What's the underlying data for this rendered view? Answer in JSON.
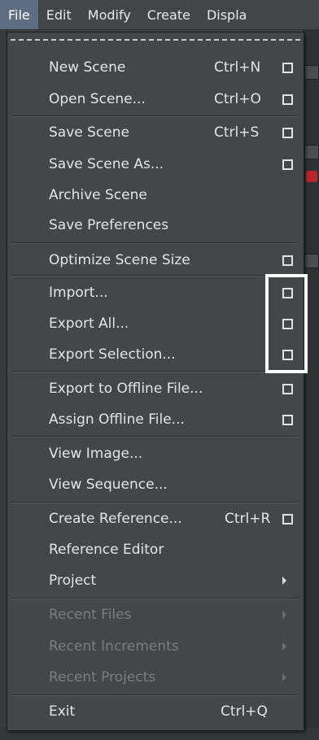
{
  "menubar": {
    "items": [
      "File",
      "Edit",
      "Modify",
      "Create",
      "Displa"
    ]
  },
  "menu": {
    "groups": {
      "scene": [
        {
          "label": "New Scene",
          "shortcut": "Ctrl+N",
          "options": true
        },
        {
          "label": "Open Scene...",
          "shortcut": "Ctrl+O",
          "options": true
        }
      ],
      "save": [
        {
          "label": "Save Scene",
          "shortcut": "Ctrl+S",
          "options": true
        },
        {
          "label": "Save Scene As...",
          "shortcut": "",
          "options": true
        },
        {
          "label": "Archive Scene",
          "shortcut": "",
          "options": false
        },
        {
          "label": "Save Preferences",
          "shortcut": "",
          "options": false
        }
      ],
      "optimize": [
        {
          "label": "Optimize Scene Size",
          "shortcut": "",
          "options": true
        }
      ],
      "io": [
        {
          "label": "Import...",
          "shortcut": "",
          "options": true
        },
        {
          "label": "Export All...",
          "shortcut": "",
          "options": true
        },
        {
          "label": "Export Selection...",
          "shortcut": "",
          "options": true
        }
      ],
      "offline": [
        {
          "label": "Export to Offline File...",
          "shortcut": "",
          "options": true
        },
        {
          "label": "Assign Offline File...",
          "shortcut": "",
          "options": true
        }
      ],
      "view": [
        {
          "label": "View Image...",
          "shortcut": "",
          "options": false
        },
        {
          "label": "View Sequence...",
          "shortcut": "",
          "options": false
        }
      ],
      "reference": [
        {
          "label": "Create Reference...",
          "shortcut": "Ctrl+R",
          "options": true
        },
        {
          "label": "Reference Editor",
          "shortcut": "",
          "options": false
        },
        {
          "label": "Project",
          "shortcut": "",
          "submenu": true
        }
      ],
      "recent": [
        {
          "label": "Recent Files",
          "submenu": true,
          "disabled": true
        },
        {
          "label": "Recent Increments",
          "submenu": true,
          "disabled": true
        },
        {
          "label": "Recent Projects",
          "submenu": true,
          "disabled": true
        }
      ],
      "exit": [
        {
          "label": "Exit",
          "shortcut": "Ctrl+Q",
          "options": false
        }
      ]
    }
  },
  "colors": {
    "menu_bg": "#444749",
    "active_menu_bg": "#5f6d82",
    "text": "#e4e4e4",
    "disabled_text": "#7a7c7f",
    "highlight_box": "#ffffff"
  }
}
